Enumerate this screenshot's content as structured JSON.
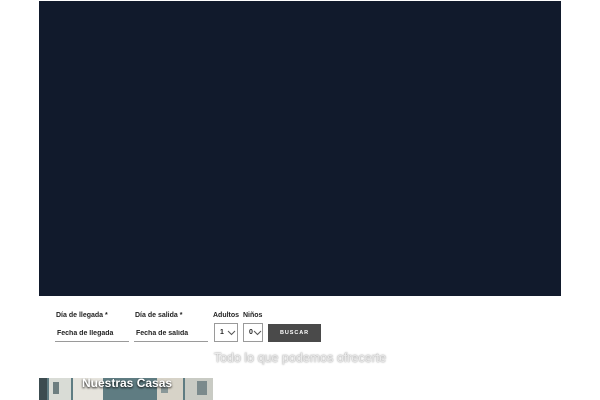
{
  "booking": {
    "arrival": {
      "label": "Día de llegada *",
      "placeholder": "Fecha de llegada"
    },
    "departure": {
      "label": "Día de salida *",
      "placeholder": "Fecha de salida"
    },
    "adults": {
      "label": "Adultos",
      "value": "1"
    },
    "children": {
      "label": "Niños",
      "value": "0"
    },
    "search_label": "BUSCAR"
  },
  "section": {
    "heading": "Todo lo que podemos ofrecerte"
  },
  "cards": [
    {
      "title": "Nuestras Casas"
    }
  ],
  "colors": {
    "hero_background": "#111a2c",
    "button_background": "#4a4a4a",
    "heading_text": "#ebebeb"
  },
  "icons": {
    "select_arrow": "chevron-down-icon"
  }
}
